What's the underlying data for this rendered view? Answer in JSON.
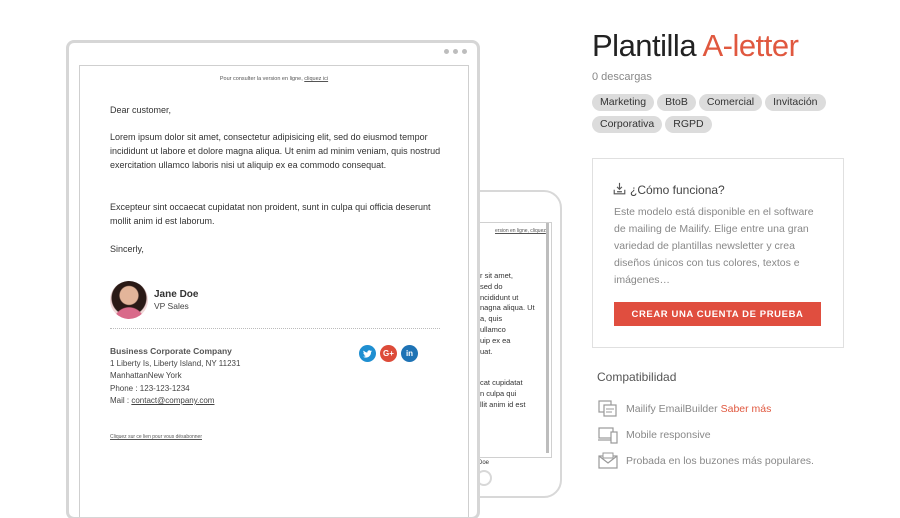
{
  "preview": {
    "top_link_text": "Pour consulter la version en ligne, ",
    "top_link_anchor": "cliquez ici",
    "greeting": "Dear customer,",
    "paragraph1": "Lorem ipsum dolor sit amet, consectetur adipisicing elit, sed do eiusmod tempor incididunt ut labore et dolore magna aliqua. Ut enim ad minim veniam, quis nostrud exercitation ullamco laboris nisi ut aliquip ex ea commodo consequat.",
    "paragraph2": "Excepteur sint occaecat cupidatat non proident, sunt in culpa qui officia deserunt mollit anim id est laborum.",
    "closing": "Sincerly,",
    "signature_name": "Jane Doe",
    "signature_title": "VP Sales",
    "company_name": "Business Corporate Company",
    "address_line1": "1 Liberty Is, Liberty Island, NY 11231",
    "address_line2": "ManhattanNew York",
    "phone": "Phone : 123-123-1234",
    "mail_label": "Mail : ",
    "mail_value": "contact@company.com",
    "social": [
      "twitter-icon",
      "google-plus-icon",
      "linkedin-icon"
    ],
    "unsubscribe": "Cliquez sur ce lien pour vous désabonner",
    "mobile": {
      "top_link": "ersion en ligne, cliquez",
      "lines": [
        "r sit amet,",
        "sed do",
        "ncididunt ut",
        "nagna aliqua. Ut",
        "a, quis",
        "ullamco",
        "uip ex ea",
        "uat.",
        "",
        "cat cupidatat",
        "n culpa qui",
        "llit anim id est"
      ],
      "bottom": "Doe"
    }
  },
  "template": {
    "title_part1": "Plantilla ",
    "title_part2": "A-letter",
    "downloads": "0 descargas",
    "tags": [
      "Marketing",
      "BtoB",
      "Comercial",
      "Invitación",
      "Corporativa",
      "RGPD"
    ]
  },
  "how_it_works": {
    "heading": "¿Cómo funciona?",
    "text": "Este modelo está disponible en el software de mailing de Mailify. Elige entre una gran variedad de plantillas newsletter y crea diseños únicos con tus colores, textos e imágenes…",
    "cta": "CREAR UNA CUENTA DE PRUEBA"
  },
  "compatibility": {
    "title": "Compatibilidad",
    "items": [
      {
        "label": "Mailify EmailBuilder",
        "link": "Saber más",
        "icon": "email-builder-icon"
      },
      {
        "label": "Mobile responsive",
        "icon": "devices-icon"
      },
      {
        "label": "Probada en los buzones más populares.",
        "icon": "mailbox-icon"
      }
    ]
  },
  "colors": {
    "accent": "#e0583f",
    "cta": "#e04e3f",
    "tag_bg": "#dcdcdc"
  }
}
